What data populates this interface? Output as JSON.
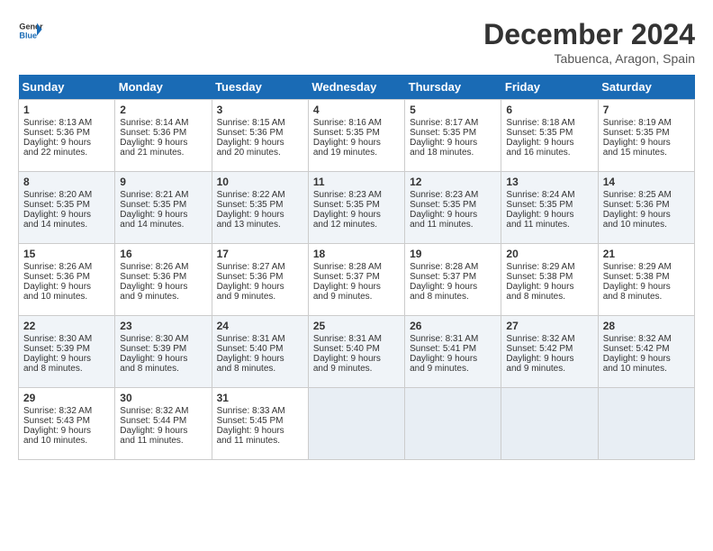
{
  "logo": {
    "text_general": "General",
    "text_blue": "Blue"
  },
  "header": {
    "month": "December 2024",
    "location": "Tabuenca, Aragon, Spain"
  },
  "weekdays": [
    "Sunday",
    "Monday",
    "Tuesday",
    "Wednesday",
    "Thursday",
    "Friday",
    "Saturday"
  ],
  "weeks": [
    [
      {
        "day": "1",
        "lines": [
          "Sunrise: 8:13 AM",
          "Sunset: 5:36 PM",
          "Daylight: 9 hours",
          "and 22 minutes."
        ]
      },
      {
        "day": "2",
        "lines": [
          "Sunrise: 8:14 AM",
          "Sunset: 5:36 PM",
          "Daylight: 9 hours",
          "and 21 minutes."
        ]
      },
      {
        "day": "3",
        "lines": [
          "Sunrise: 8:15 AM",
          "Sunset: 5:36 PM",
          "Daylight: 9 hours",
          "and 20 minutes."
        ]
      },
      {
        "day": "4",
        "lines": [
          "Sunrise: 8:16 AM",
          "Sunset: 5:35 PM",
          "Daylight: 9 hours",
          "and 19 minutes."
        ]
      },
      {
        "day": "5",
        "lines": [
          "Sunrise: 8:17 AM",
          "Sunset: 5:35 PM",
          "Daylight: 9 hours",
          "and 18 minutes."
        ]
      },
      {
        "day": "6",
        "lines": [
          "Sunrise: 8:18 AM",
          "Sunset: 5:35 PM",
          "Daylight: 9 hours",
          "and 16 minutes."
        ]
      },
      {
        "day": "7",
        "lines": [
          "Sunrise: 8:19 AM",
          "Sunset: 5:35 PM",
          "Daylight: 9 hours",
          "and 15 minutes."
        ]
      }
    ],
    [
      {
        "day": "8",
        "lines": [
          "Sunrise: 8:20 AM",
          "Sunset: 5:35 PM",
          "Daylight: 9 hours",
          "and 14 minutes."
        ]
      },
      {
        "day": "9",
        "lines": [
          "Sunrise: 8:21 AM",
          "Sunset: 5:35 PM",
          "Daylight: 9 hours",
          "and 14 minutes."
        ]
      },
      {
        "day": "10",
        "lines": [
          "Sunrise: 8:22 AM",
          "Sunset: 5:35 PM",
          "Daylight: 9 hours",
          "and 13 minutes."
        ]
      },
      {
        "day": "11",
        "lines": [
          "Sunrise: 8:23 AM",
          "Sunset: 5:35 PM",
          "Daylight: 9 hours",
          "and 12 minutes."
        ]
      },
      {
        "day": "12",
        "lines": [
          "Sunrise: 8:23 AM",
          "Sunset: 5:35 PM",
          "Daylight: 9 hours",
          "and 11 minutes."
        ]
      },
      {
        "day": "13",
        "lines": [
          "Sunrise: 8:24 AM",
          "Sunset: 5:35 PM",
          "Daylight: 9 hours",
          "and 11 minutes."
        ]
      },
      {
        "day": "14",
        "lines": [
          "Sunrise: 8:25 AM",
          "Sunset: 5:36 PM",
          "Daylight: 9 hours",
          "and 10 minutes."
        ]
      }
    ],
    [
      {
        "day": "15",
        "lines": [
          "Sunrise: 8:26 AM",
          "Sunset: 5:36 PM",
          "Daylight: 9 hours",
          "and 10 minutes."
        ]
      },
      {
        "day": "16",
        "lines": [
          "Sunrise: 8:26 AM",
          "Sunset: 5:36 PM",
          "Daylight: 9 hours",
          "and 9 minutes."
        ]
      },
      {
        "day": "17",
        "lines": [
          "Sunrise: 8:27 AM",
          "Sunset: 5:36 PM",
          "Daylight: 9 hours",
          "and 9 minutes."
        ]
      },
      {
        "day": "18",
        "lines": [
          "Sunrise: 8:28 AM",
          "Sunset: 5:37 PM",
          "Daylight: 9 hours",
          "and 9 minutes."
        ]
      },
      {
        "day": "19",
        "lines": [
          "Sunrise: 8:28 AM",
          "Sunset: 5:37 PM",
          "Daylight: 9 hours",
          "and 8 minutes."
        ]
      },
      {
        "day": "20",
        "lines": [
          "Sunrise: 8:29 AM",
          "Sunset: 5:38 PM",
          "Daylight: 9 hours",
          "and 8 minutes."
        ]
      },
      {
        "day": "21",
        "lines": [
          "Sunrise: 8:29 AM",
          "Sunset: 5:38 PM",
          "Daylight: 9 hours",
          "and 8 minutes."
        ]
      }
    ],
    [
      {
        "day": "22",
        "lines": [
          "Sunrise: 8:30 AM",
          "Sunset: 5:39 PM",
          "Daylight: 9 hours",
          "and 8 minutes."
        ]
      },
      {
        "day": "23",
        "lines": [
          "Sunrise: 8:30 AM",
          "Sunset: 5:39 PM",
          "Daylight: 9 hours",
          "and 8 minutes."
        ]
      },
      {
        "day": "24",
        "lines": [
          "Sunrise: 8:31 AM",
          "Sunset: 5:40 PM",
          "Daylight: 9 hours",
          "and 8 minutes."
        ]
      },
      {
        "day": "25",
        "lines": [
          "Sunrise: 8:31 AM",
          "Sunset: 5:40 PM",
          "Daylight: 9 hours",
          "and 9 minutes."
        ]
      },
      {
        "day": "26",
        "lines": [
          "Sunrise: 8:31 AM",
          "Sunset: 5:41 PM",
          "Daylight: 9 hours",
          "and 9 minutes."
        ]
      },
      {
        "day": "27",
        "lines": [
          "Sunrise: 8:32 AM",
          "Sunset: 5:42 PM",
          "Daylight: 9 hours",
          "and 9 minutes."
        ]
      },
      {
        "day": "28",
        "lines": [
          "Sunrise: 8:32 AM",
          "Sunset: 5:42 PM",
          "Daylight: 9 hours",
          "and 10 minutes."
        ]
      }
    ],
    [
      {
        "day": "29",
        "lines": [
          "Sunrise: 8:32 AM",
          "Sunset: 5:43 PM",
          "Daylight: 9 hours",
          "and 10 minutes."
        ]
      },
      {
        "day": "30",
        "lines": [
          "Sunrise: 8:32 AM",
          "Sunset: 5:44 PM",
          "Daylight: 9 hours",
          "and 11 minutes."
        ]
      },
      {
        "day": "31",
        "lines": [
          "Sunrise: 8:33 AM",
          "Sunset: 5:45 PM",
          "Daylight: 9 hours",
          "and 11 minutes."
        ]
      },
      null,
      null,
      null,
      null
    ]
  ]
}
